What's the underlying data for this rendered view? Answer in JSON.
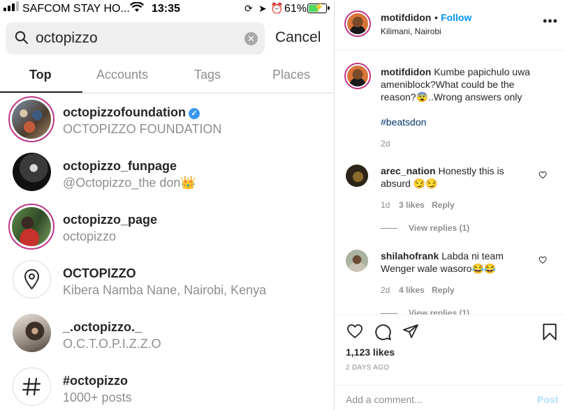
{
  "status_bar": {
    "carrier": "SAFCOM STAY HO...",
    "time": "13:35",
    "battery": "61%",
    "battery_level": 0.61
  },
  "search": {
    "query": "octopizzo",
    "cancel_label": "Cancel"
  },
  "tabs": [
    {
      "label": "Top",
      "active": true
    },
    {
      "label": "Accounts",
      "active": false
    },
    {
      "label": "Tags",
      "active": false
    },
    {
      "label": "Places",
      "active": false
    }
  ],
  "results": [
    {
      "name": "octopizzofoundation",
      "sub": "OCTOPIZZO FOUNDATION",
      "kind": "account",
      "verified": true
    },
    {
      "name": "octopizzo_funpage",
      "sub": "@Octopizzo_the don👑",
      "kind": "account"
    },
    {
      "name": "octopizzo_page",
      "sub": "octopizzo",
      "kind": "account"
    },
    {
      "name": "OCTOPIZZO",
      "sub": "Kibera Namba Nane, Nairobi, Kenya",
      "kind": "place",
      "icon": "location-pin-icon"
    },
    {
      "name": "_.octopizzo._",
      "sub": "O.C.T.O.P.I.Z.Z.O",
      "kind": "account"
    },
    {
      "name": "#octopizzo",
      "sub": "1000+ posts",
      "kind": "hashtag",
      "icon": "hashtag-icon"
    }
  ],
  "post": {
    "username": "motifdidon",
    "separator": "•",
    "follow_label": "Follow",
    "location": "Kilimani, Nairobi",
    "caption": {
      "username": "motifdidon",
      "text": "Kumbe papichulo uwa ameniblock?What could be the reason?😨..Wrong answers only",
      "hashtag": "#beatsdon",
      "time": "2d"
    },
    "comments": [
      {
        "username": "arec_nation",
        "text": "Honestly this is absurd 😏😏",
        "time": "1d",
        "likes": "3 likes",
        "reply_label": "Reply",
        "view_replies": "View replies (1)"
      },
      {
        "username": "shilahofrank",
        "text": "Labda ni team Wenger wale wasoro😂😂",
        "time": "2d",
        "likes": "4 likes",
        "reply_label": "Reply",
        "view_replies": "View replies (1)"
      }
    ],
    "likes": "1,123 likes",
    "posted_ago": "2 DAYS AGO",
    "add_comment_placeholder": "Add a comment...",
    "post_label": "Post"
  },
  "colors": {
    "link_blue": "#0095f6",
    "muted": "#8e8e8e",
    "story_ring": "#c13584",
    "hashtag": "#00376b"
  }
}
